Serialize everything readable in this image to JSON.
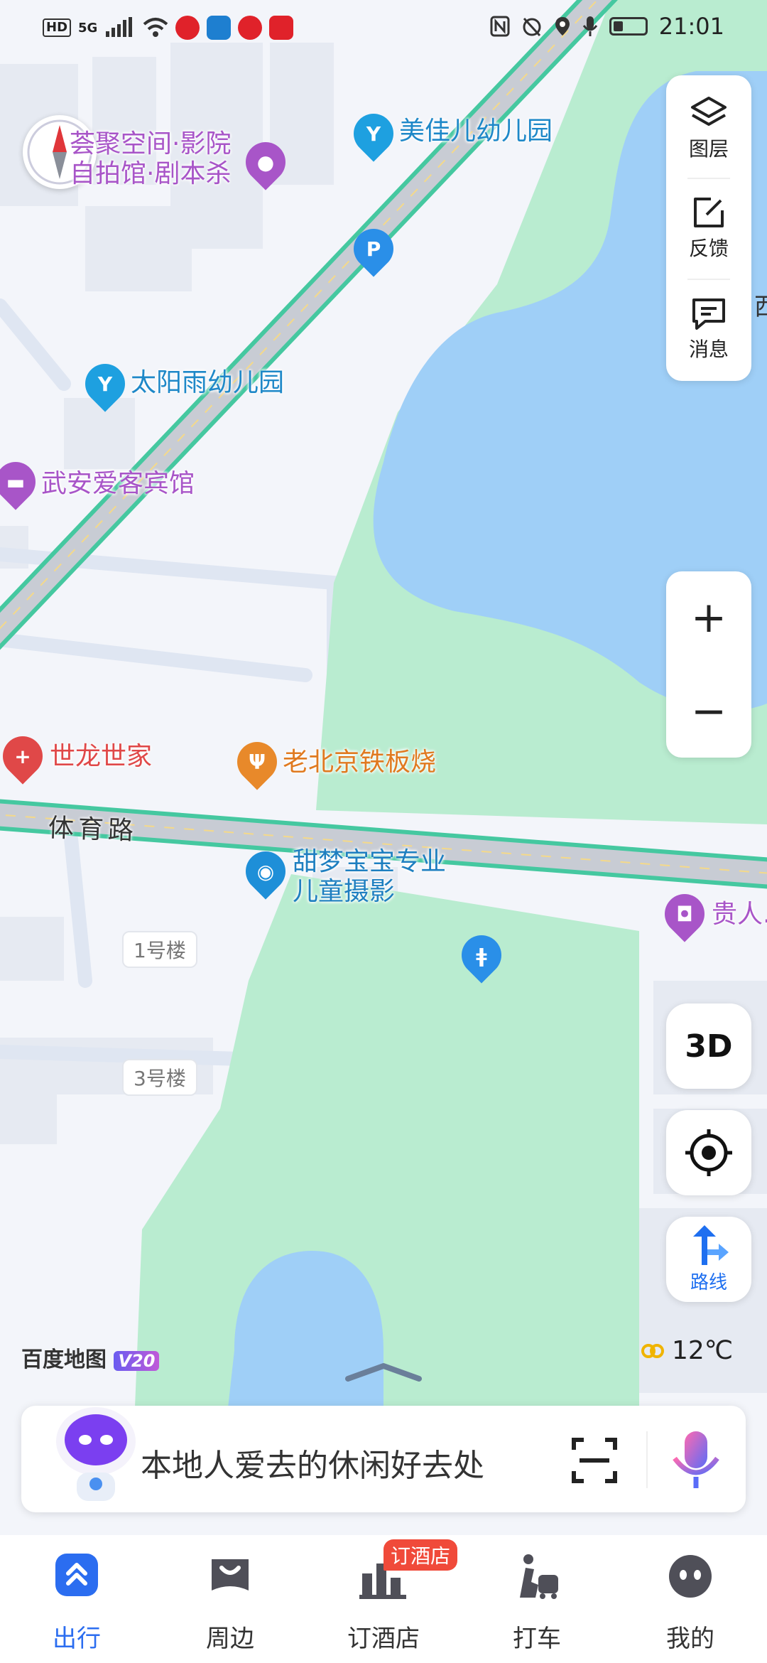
{
  "status_bar": {
    "left_tags": [
      "HD",
      "5G"
    ],
    "time": "21:01",
    "icons": [
      "nfc-icon",
      "alarm-icon",
      "location-icon",
      "mic-icon",
      "battery-icon"
    ],
    "battery_level": 0.3
  },
  "map": {
    "colors": {
      "land": "#f3f5fa",
      "park": "#b9ecd0",
      "water": "#9fcff7",
      "road": "#c8ccd4",
      "road_edge": "#45c8a0",
      "block": "#e6eaf2"
    },
    "pois": [
      {
        "id": "cinema",
        "label_lines": [
          "荟聚空间·影院",
          "自拍馆·剧本杀"
        ],
        "color": "#a855c8",
        "icon": "film-icon"
      },
      {
        "id": "kindergarten-1",
        "label_lines": [
          "美佳儿幼儿园"
        ],
        "color": "#1ea0e0",
        "icon": "kindergarten-icon"
      },
      {
        "id": "parking",
        "label_lines": [
          ""
        ],
        "color": "#2a8fe8",
        "icon": "parking-icon"
      },
      {
        "id": "kindergarten-2",
        "label_lines": [
          "太阳雨幼儿园"
        ],
        "color": "#1ea0e0",
        "icon": "kindergarten-icon"
      },
      {
        "id": "hotel",
        "label_lines": [
          "武安爱客宾馆"
        ],
        "color": "#a855c8",
        "icon": "bed-icon"
      },
      {
        "id": "clinic",
        "label_lines": [
          "世龙世家"
        ],
        "color": "#e04848",
        "icon": "medical-cross-icon"
      },
      {
        "id": "restaurant",
        "label_lines": [
          "老北京铁板烧"
        ],
        "color": "#e8892a",
        "icon": "fork-knife-icon"
      },
      {
        "id": "photo",
        "label_lines": [
          "甜梦宝宝专业",
          "儿童摄影"
        ],
        "color": "#1e8fd8",
        "icon": "camera-icon"
      },
      {
        "id": "shop",
        "label_lines": [
          "贵人..."
        ],
        "color": "#a855c8",
        "icon": "shopping-bag-icon"
      },
      {
        "id": "toilet",
        "label_lines": [
          ""
        ],
        "color": "#2a8fe8",
        "icon": "restroom-icon"
      }
    ],
    "road_name": "体育路",
    "buildings": [
      "1号楼",
      "3号楼"
    ],
    "edge_label": "西"
  },
  "right_panel": {
    "items": [
      {
        "label": "图层",
        "icon": "layers-icon"
      },
      {
        "label": "反馈",
        "icon": "feedback-edit-icon"
      },
      {
        "label": "消息",
        "icon": "message-icon"
      }
    ]
  },
  "zoom": {
    "in": "+",
    "out": "−"
  },
  "buttons": {
    "three_d": "3D",
    "route": "路线"
  },
  "brand": {
    "name": "百度地图",
    "version": "V20"
  },
  "weather": {
    "temp": "12℃",
    "icon": "haze-icon"
  },
  "search": {
    "placeholder": "本地人爱去的休闲好去处"
  },
  "tabs": [
    {
      "label": "出行",
      "active": true,
      "icon": "travel-icon"
    },
    {
      "label": "周边",
      "active": false,
      "icon": "nearby-bag-icon"
    },
    {
      "label": "订酒店",
      "active": false,
      "icon": "hotel-building-icon",
      "badge": "订酒店"
    },
    {
      "label": "打车",
      "active": false,
      "icon": "taxi-icon"
    },
    {
      "label": "我的",
      "active": false,
      "icon": "profile-icon"
    }
  ],
  "accent_color": "#2b6df0"
}
